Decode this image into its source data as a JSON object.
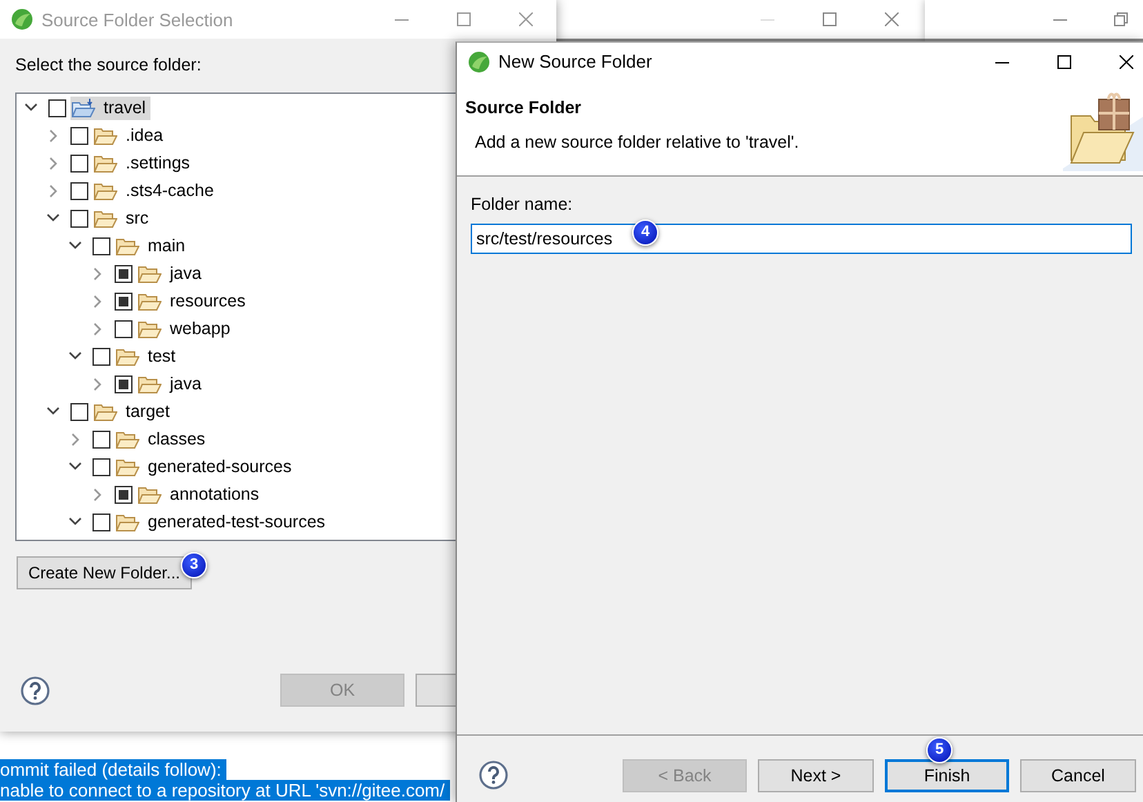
{
  "selection_dialog": {
    "title": "Source Folder Selection",
    "prompt": "Select the source folder:",
    "tree": [
      {
        "label": "travel",
        "kind": "project",
        "expanded": true,
        "checked": false,
        "selected": true,
        "children": [
          {
            "label": ".idea",
            "kind": "folder",
            "expanded": false,
            "checked": false,
            "selected": false
          },
          {
            "label": ".settings",
            "kind": "folder",
            "expanded": false,
            "checked": false,
            "selected": false
          },
          {
            "label": ".sts4-cache",
            "kind": "folder",
            "expanded": false,
            "checked": false,
            "selected": false
          },
          {
            "label": "src",
            "kind": "folder",
            "expanded": true,
            "checked": false,
            "selected": false,
            "children": [
              {
                "label": "main",
                "kind": "folder",
                "expanded": true,
                "checked": false,
                "selected": false,
                "children": [
                  {
                    "label": "java",
                    "kind": "folder",
                    "expanded": false,
                    "checked": true,
                    "selected": false
                  },
                  {
                    "label": "resources",
                    "kind": "folder",
                    "expanded": false,
                    "checked": true,
                    "selected": false
                  },
                  {
                    "label": "webapp",
                    "kind": "folder",
                    "expanded": false,
                    "checked": false,
                    "selected": false
                  }
                ]
              },
              {
                "label": "test",
                "kind": "folder",
                "expanded": true,
                "checked": false,
                "selected": false,
                "children": [
                  {
                    "label": "java",
                    "kind": "folder",
                    "expanded": false,
                    "checked": true,
                    "selected": false
                  }
                ]
              }
            ]
          },
          {
            "label": "target",
            "kind": "folder",
            "expanded": true,
            "checked": false,
            "selected": false,
            "children": [
              {
                "label": "classes",
                "kind": "folder",
                "expanded": false,
                "checked": false,
                "selected": false
              },
              {
                "label": "generated-sources",
                "kind": "folder",
                "expanded": true,
                "checked": false,
                "selected": false,
                "children": [
                  {
                    "label": "annotations",
                    "kind": "folder",
                    "expanded": false,
                    "checked": true,
                    "selected": false
                  }
                ]
              },
              {
                "label": "generated-test-sources",
                "kind": "folder",
                "expanded": true,
                "checked": false,
                "selected": false
              }
            ]
          }
        ]
      }
    ],
    "create_button": {
      "label": "Create New Folder...",
      "badge": "3"
    },
    "buttons": [
      {
        "label": "OK",
        "disabled": true
      },
      {
        "disabled": false
      }
    ]
  },
  "console": {
    "lines": [
      {
        "text": "ommit failed (details follow):",
        "selected": true
      },
      {
        "text": "nable to connect to a repository at URL 'svn://gitee.com/",
        "selected": true
      }
    ]
  },
  "wizard": {
    "title": "New Source Folder",
    "heading": "Source Folder",
    "description": "Add a new source folder relative to 'travel'.",
    "field": {
      "label": "Folder name:",
      "value": "src/test/resources",
      "focused": true,
      "badge": "4"
    },
    "buttons": [
      {
        "label": "< Back",
        "disabled": true,
        "focused": false
      },
      {
        "label": "Next >",
        "disabled": false,
        "focused": false
      },
      {
        "label": "Finish",
        "disabled": false,
        "focused": true,
        "badge": "5"
      },
      {
        "label": "Cancel",
        "disabled": false,
        "focused": false
      }
    ]
  }
}
